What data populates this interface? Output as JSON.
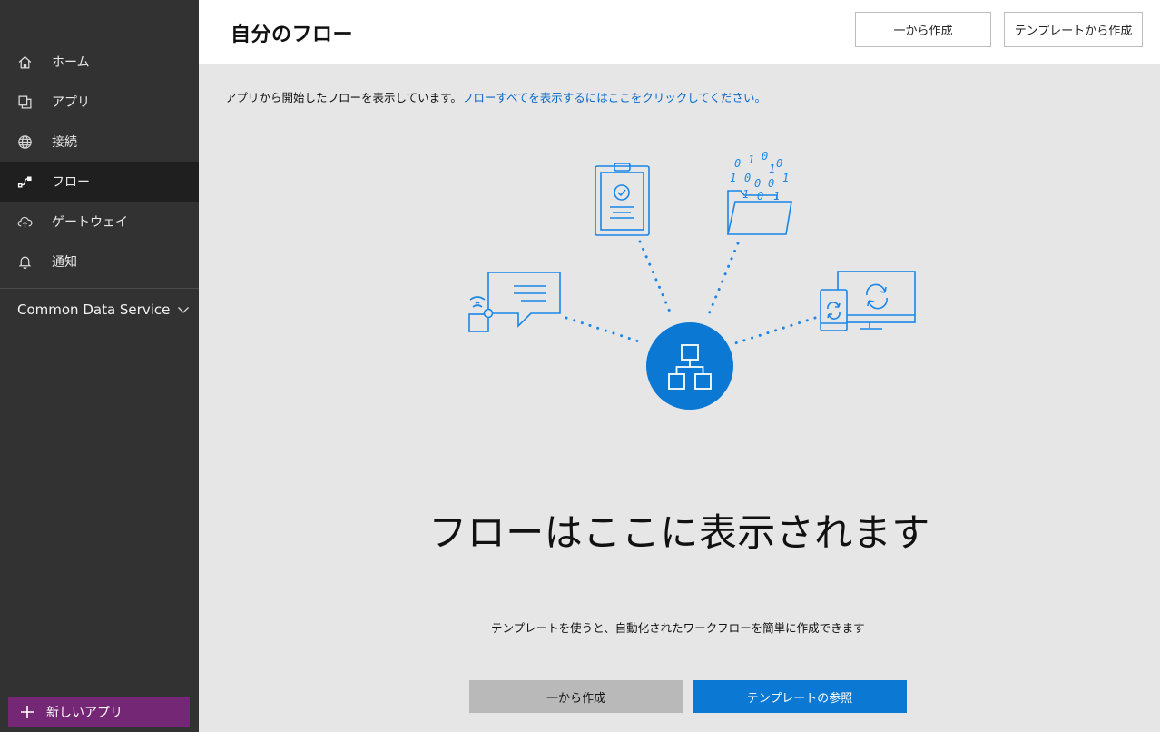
{
  "sidebar": {
    "items": [
      {
        "label": "ホーム",
        "icon": "home-icon"
      },
      {
        "label": "アプリ",
        "icon": "apps-icon"
      },
      {
        "label": "接続",
        "icon": "globe-icon"
      },
      {
        "label": "フロー",
        "icon": "flow-icon",
        "active": true
      },
      {
        "label": "ゲートウェイ",
        "icon": "cloud-upload-icon"
      },
      {
        "label": "通知",
        "icon": "bell-icon"
      }
    ],
    "section_label": "Common Data Service",
    "new_app_label": "新しいアプリ"
  },
  "header": {
    "title": "自分のフロー",
    "blank_button": "一から作成",
    "template_button": "テンプレートから作成"
  },
  "notice": {
    "text": "アプリから開始したフローを表示しています。",
    "link": "フローすべてを表示するにはここをクリックしてください。"
  },
  "empty_state": {
    "title": "フローはここに表示されます",
    "subtitle": "テンプレートを使うと、自動化されたワークフローを簡単に作成できます",
    "blank_button": "一から作成",
    "browse_button": "テンプレートの参照"
  },
  "colors": {
    "sidebar_bg": "#323232",
    "accent_blue": "#0b78d4",
    "new_app_purple": "#742774",
    "link_blue": "#0b67c8"
  }
}
